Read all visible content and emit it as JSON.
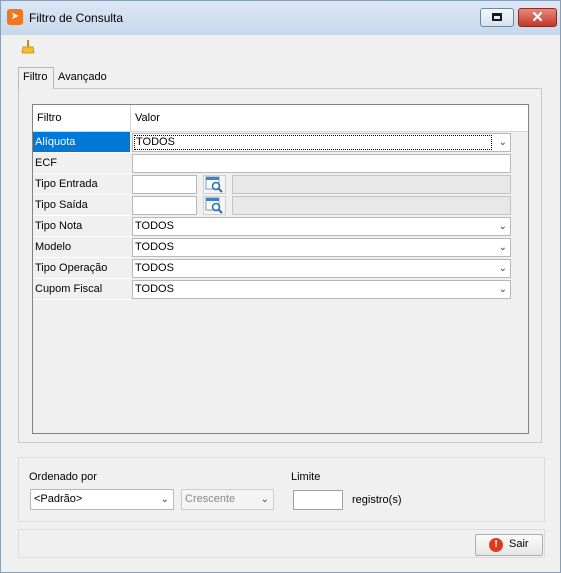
{
  "window": {
    "title": "Filtro de Consulta"
  },
  "tabs": [
    {
      "label": "Filtro"
    },
    {
      "label": "Avançado"
    }
  ],
  "grid": {
    "headers": {
      "filter": "Filtro",
      "value": "Valor"
    },
    "rows": [
      {
        "label": "Alíquota",
        "value": "TODOS",
        "kind": "combo"
      },
      {
        "label": "ECF",
        "value": "",
        "kind": "text"
      },
      {
        "label": "Tipo Entrada",
        "value": "",
        "kind": "lookup"
      },
      {
        "label": "Tipo Saída",
        "value": "",
        "kind": "lookup"
      },
      {
        "label": "Tipo Nota",
        "value": "TODOS",
        "kind": "combo"
      },
      {
        "label": "Modelo",
        "value": "TODOS",
        "kind": "combo"
      },
      {
        "label": "Tipo Operação",
        "value": "TODOS",
        "kind": "combo"
      },
      {
        "label": "Cupom Fiscal",
        "value": "TODOS",
        "kind": "combo"
      }
    ]
  },
  "ordering": {
    "label": "Ordenado por",
    "field_value": "<Padrão>",
    "direction_value": "Crescente"
  },
  "limit": {
    "label": "Limite",
    "value": "",
    "unit": "registro(s)"
  },
  "footer": {
    "exit_label": "Sair"
  },
  "colors": {
    "selection": "#0078d7",
    "close": "#c2392c",
    "accent": "#f2761d"
  }
}
